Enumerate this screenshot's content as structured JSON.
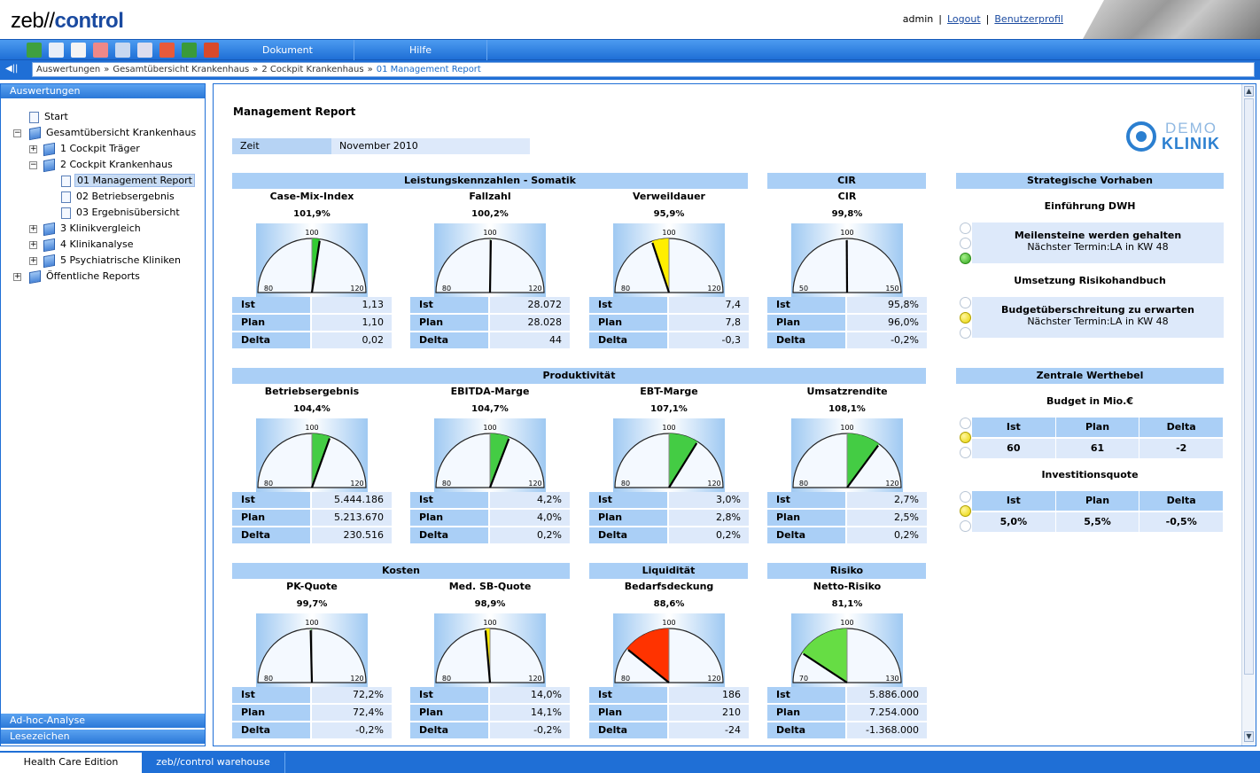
{
  "app": {
    "logo_a": "zeb//",
    "logo_b": "control",
    "user": "admin",
    "logout": "Logout",
    "profile": "Benutzerprofil",
    "sep": "|"
  },
  "menu": {
    "dokument": "Dokument",
    "hilfe": "Hilfe"
  },
  "breadcrumb": {
    "items": [
      "Auswertungen",
      "Gesamtübersicht Krankenhaus",
      "2 Cockpit Krankenhaus"
    ],
    "current": "01 Management Report",
    "sep": "»"
  },
  "sidebar": {
    "head": "Auswertungen",
    "adhoc": "Ad-hoc-Analyse",
    "bookmarks": "Lesezeichen",
    "tree": [
      {
        "label": "Start"
      },
      {
        "label": "Gesamtübersicht Krankenhaus"
      },
      {
        "label": "1 Cockpit Träger"
      },
      {
        "label": "2 Cockpit Krankenhaus"
      },
      {
        "label": "01 Management Report"
      },
      {
        "label": "02 Betriebsergebnis"
      },
      {
        "label": "03 Ergebnisübersicht"
      },
      {
        "label": "3 Klinikvergleich"
      },
      {
        "label": "4 Klinikanalyse"
      },
      {
        "label": "5 Psychiatrische Kliniken"
      },
      {
        "label": "Öffentliche Reports"
      }
    ]
  },
  "report": {
    "title": "Management Report",
    "zeit_label": "Zeit",
    "zeit_value": "November 2010",
    "logo_top": "DEMO",
    "logo_bottom": "KLINIK",
    "row_labels": {
      "ist": "Ist",
      "plan": "Plan",
      "delta": "Delta"
    },
    "sections": [
      {
        "title": "Leistungskennzahlen - Somatik"
      },
      {
        "title": "CIR"
      },
      {
        "title": "Produktivität"
      },
      {
        "title": "Kosten"
      },
      {
        "title": "Liquidität"
      },
      {
        "title": "Risiko"
      }
    ],
    "kpis": [
      {
        "title": "Case-Mix-Index",
        "pct": "101,9%",
        "min": "80",
        "mid": "100",
        "max": "120",
        "value": 101.9,
        "lo": 80,
        "hi": 120,
        "color": "#33cc33",
        "ist": "1,13",
        "plan": "1,10",
        "delta": "0,02"
      },
      {
        "title": "Fallzahl",
        "pct": "100,2%",
        "min": "80",
        "mid": "100",
        "max": "120",
        "value": 100.2,
        "lo": 80,
        "hi": 120,
        "color": "#33cc33",
        "ist": "28.072",
        "plan": "28.028",
        "delta": "44"
      },
      {
        "title": "Verweildauer",
        "pct": "95,9%",
        "min": "80",
        "mid": "100",
        "max": "120",
        "value": 95.9,
        "lo": 80,
        "hi": 120,
        "color": "#ffee00",
        "ist": "7,4",
        "plan": "7,8",
        "delta": "-0,3"
      },
      {
        "title": "CIR",
        "pct": "99,8%",
        "min": "50",
        "mid": "100",
        "max": "150",
        "value": 99.8,
        "lo": 50,
        "hi": 150,
        "color": "#33cc33",
        "ist": "95,8%",
        "plan": "96,0%",
        "delta": "-0,2%"
      },
      {
        "title": "Betriebsergebnis",
        "pct": "104,4%",
        "min": "80",
        "mid": "100",
        "max": "120",
        "value": 104.4,
        "lo": 80,
        "hi": 120,
        "color": "#44cc44",
        "ist": "5.444.186",
        "plan": "5.213.670",
        "delta": "230.516"
      },
      {
        "title": "EBITDA-Marge",
        "pct": "104,7%",
        "min": "80",
        "mid": "100",
        "max": "120",
        "value": 104.7,
        "lo": 80,
        "hi": 120,
        "color": "#44cc44",
        "ist": "4,2%",
        "plan": "4,0%",
        "delta": "0,2%"
      },
      {
        "title": "EBT-Marge",
        "pct": "107,1%",
        "min": "80",
        "mid": "100",
        "max": "120",
        "value": 107.1,
        "lo": 80,
        "hi": 120,
        "color": "#44cc44",
        "ist": "3,0%",
        "plan": "2,8%",
        "delta": "0,2%"
      },
      {
        "title": "Umsatzrendite",
        "pct": "108,1%",
        "min": "80",
        "mid": "100",
        "max": "120",
        "value": 108.1,
        "lo": 80,
        "hi": 120,
        "color": "#44cc44",
        "ist": "2,7%",
        "plan": "2,5%",
        "delta": "0,2%"
      },
      {
        "title": "PK-Quote",
        "pct": "99,7%",
        "min": "80",
        "mid": "100",
        "max": "120",
        "value": 99.7,
        "lo": 80,
        "hi": 120,
        "color": "#33cc33",
        "ist": "72,2%",
        "plan": "72,4%",
        "delta": "-0,2%"
      },
      {
        "title": "Med. SB-Quote",
        "pct": "98,9%",
        "min": "80",
        "mid": "100",
        "max": "120",
        "value": 98.9,
        "lo": 80,
        "hi": 120,
        "color": "#ffee00",
        "ist": "14,0%",
        "plan": "14,1%",
        "delta": "-0,2%"
      },
      {
        "title": "Bedarfsdeckung",
        "pct": "88,6%",
        "min": "80",
        "mid": "100",
        "max": "120",
        "value": 88.6,
        "lo": 80,
        "hi": 120,
        "color": "#ff3300",
        "ist": "186",
        "plan": "210",
        "delta": "-24"
      },
      {
        "title": "Netto-Risiko",
        "pct": "81,1%",
        "min": "70",
        "mid": "100",
        "max": "130",
        "value": 81.1,
        "lo": 70,
        "hi": 130,
        "color": "#66dd44",
        "ist": "5.886.000",
        "plan": "7.254.000",
        "delta": "-1.368.000"
      }
    ],
    "strategic": {
      "head": "Strategische Vorhaben",
      "items": [
        {
          "title": "Einführung DWH",
          "line1": "Meilensteine werden gehalten",
          "line2": "Nächster Termin:LA in KW 48",
          "status": "green"
        },
        {
          "title": "Umsetzung Risikohandbuch",
          "line1": "Budgetüberschreitung zu erwarten",
          "line2": "Nächster Termin:LA in KW 48",
          "status": "yellow"
        }
      ]
    },
    "werthebel": {
      "head": "Zentrale Werthebel",
      "items": [
        {
          "title": "Budget in Mio.€",
          "ist": "60",
          "plan": "61",
          "delta": "-2",
          "status": "yellow"
        },
        {
          "title": "Investitionsquote",
          "ist": "5,0%",
          "plan": "5,5%",
          "delta": "-0,5%",
          "status": "yellow"
        }
      ]
    }
  },
  "footer": {
    "tab1": "Health Care Edition",
    "tab2": "zeb//control warehouse"
  }
}
